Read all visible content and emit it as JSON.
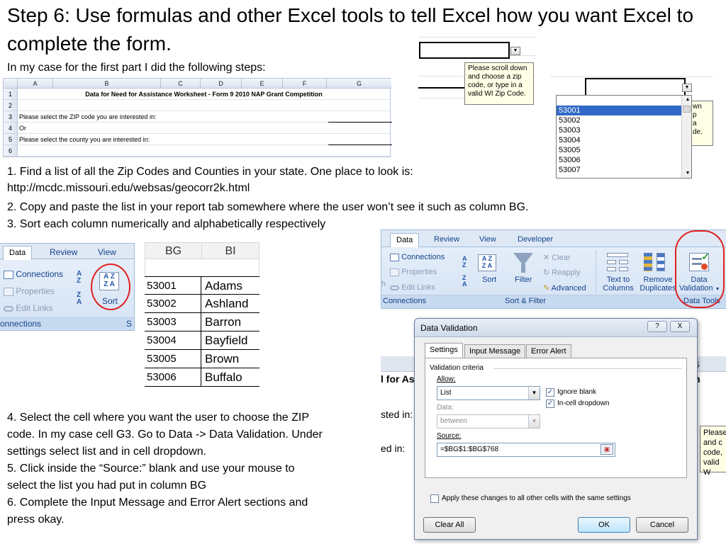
{
  "slide": {
    "title": "Step 6: Use formulas and other Excel tools to tell Excel how you want Excel to complete the form.",
    "intro": "In my case for the first part I did the following steps:",
    "step1a": "1. Find a list of all the Zip Codes and Counties in your state. One place to look is:",
    "step1b": "http://mcdc.missouri.edu/websas/geocorr2k.html",
    "step2": "2. Copy and paste the list in your report tab somewhere where the user won’t see it such as column BG.",
    "step3": "3. Sort each column numerically and alphabetically respectively",
    "steps_bottom": [
      "4. Select the cell where you want the user to choose the ZIP",
      "code. In my case cell G3. Go to Data -> Data Validation. Under",
      "settings select list and in cell dropdown.",
      "5. Click inside the “Source:” blank and use your mouse to",
      "select the list you had put in column BG",
      "6. Complete the Input Message and Error Alert sections and",
      "press okay."
    ]
  },
  "sheet": {
    "columns": [
      "A",
      "B",
      "C",
      "D",
      "E",
      "F",
      "G"
    ],
    "rows": [
      "1",
      "2",
      "3",
      "4",
      "5",
      "6"
    ],
    "title": "Data for Need for Assistance Worksheet - Form 9 2010 NAP Grant Competition",
    "r3": "Please select the ZIP code you are interested in:",
    "r4": "Or",
    "r5": "Please select the county you are interested in:"
  },
  "tooltip": {
    "lines": [
      "Please scroll down",
      "and choose a zip",
      "code, or type in a",
      "valid WI Zip Code."
    ]
  },
  "zip_list": {
    "items": [
      "53001",
      "53002",
      "53003",
      "53004",
      "53005",
      "53006",
      "53007"
    ],
    "selected": "53001",
    "partial_tip": [
      "wn",
      "p",
      "a",
      "de."
    ]
  },
  "ribbon_small": {
    "tabs": [
      "Data",
      "Review",
      "View"
    ],
    "connections": "Connections",
    "properties": "Properties",
    "edit_links": "Edit Links",
    "sort": "Sort",
    "group_label": "onnections",
    "group_cut": "S"
  },
  "bg_table": {
    "headers": [
      "BG",
      "BI"
    ],
    "rows": [
      [
        "53001",
        "Adams"
      ],
      [
        "53002",
        "Ashland"
      ],
      [
        "53003",
        "Barron"
      ],
      [
        "53004",
        "Bayfield"
      ],
      [
        "53005",
        "Brown"
      ],
      [
        "53006",
        "Buffalo"
      ]
    ]
  },
  "ribbon_big": {
    "tabs": [
      "Data",
      "Review",
      "View",
      "Developer"
    ],
    "connections": "Connections",
    "properties": "Properties",
    "edit_links": "Edit Links",
    "sort": "Sort",
    "filter": "Filter",
    "clear": "Clear",
    "reapply": "Reapply",
    "advanced": "Advanced",
    "text_to_columns_1": "Text to",
    "text_to_columns_2": "Columns",
    "remove_dup_1": "Remove",
    "remove_dup_2": "Duplicates",
    "data_val_1": "Data",
    "data_val_2": "Validation",
    "group_connections": "Connections",
    "group_sort_filter": "Sort & Filter",
    "group_data_tools": "Data Tools",
    "cut_h": "h"
  },
  "bg_sheet_frag": {
    "g": "G",
    "for_as": "l for As",
    "h": "h",
    "sted_in": "sted in:",
    "ed_in": "ed in:",
    "tip": [
      "Please",
      "and c",
      "code,",
      "valid W"
    ]
  },
  "dialog": {
    "title": "Data Validation",
    "help": "?",
    "close": "X",
    "tabs": [
      "Settings",
      "Input Message",
      "Error Alert"
    ],
    "criteria": "Validation criteria",
    "allow_label": "Allow:",
    "allow_value": "List",
    "ignore_blank": "Ignore blank",
    "in_cell": "In-cell dropdown",
    "data_label": "Data:",
    "data_value": "between",
    "source_label": "Source:",
    "source_value": "=$BG$1:$BG$768",
    "apply_all": "Apply these changes to all other cells with the same settings",
    "clear_all": "Clear All",
    "ok": "OK",
    "cancel": "Cancel"
  }
}
